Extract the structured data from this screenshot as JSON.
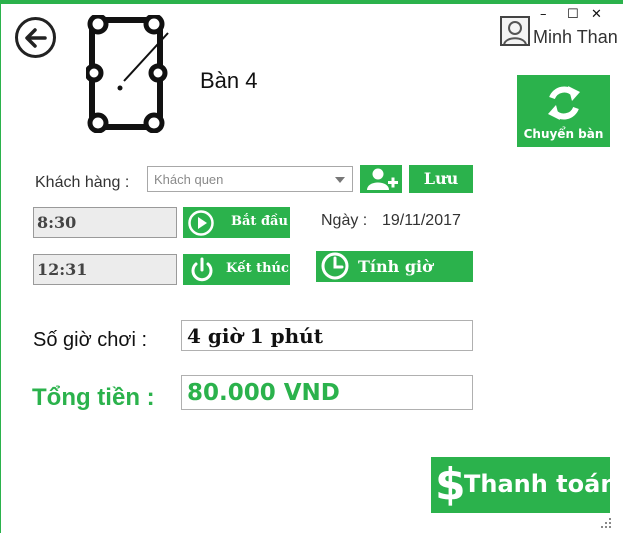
{
  "window": {
    "minimize": "–",
    "maximize": "☐",
    "close": "✕",
    "accent_color": "#2bb24c"
  },
  "header": {
    "back_icon": "arrow-left-circle-icon",
    "table_icon": "billiard-table-icon",
    "table_name": "Bàn 4"
  },
  "user": {
    "avatar_icon": "user-avatar-icon",
    "name": "Minh Than"
  },
  "transfer": {
    "icon": "sync-arrows-icon",
    "label": "Chuyển bàn"
  },
  "customer": {
    "label": "Khách hàng :",
    "selected": "Khách quen",
    "add_icon": "add-user-icon",
    "save_label": "Lưu"
  },
  "time": {
    "start_value": "8:30",
    "start_label": "Bắt đầu",
    "start_icon": "play-circle-icon",
    "end_value": "12:31",
    "end_label": "Kết thúc",
    "end_icon": "power-icon",
    "date_label": "Ngày :",
    "date_value": "19/11/2017",
    "calc_label": "Tính giờ",
    "calc_icon": "clock-icon"
  },
  "summary": {
    "hours_label": "Số giờ chơi :",
    "hours_value": "4 giờ 1 phút",
    "total_label": "Tổng tiền :",
    "total_value": "80.000 VND"
  },
  "payment": {
    "icon": "dollar-icon",
    "icon_glyph": "$",
    "label": "Thanh toán"
  }
}
